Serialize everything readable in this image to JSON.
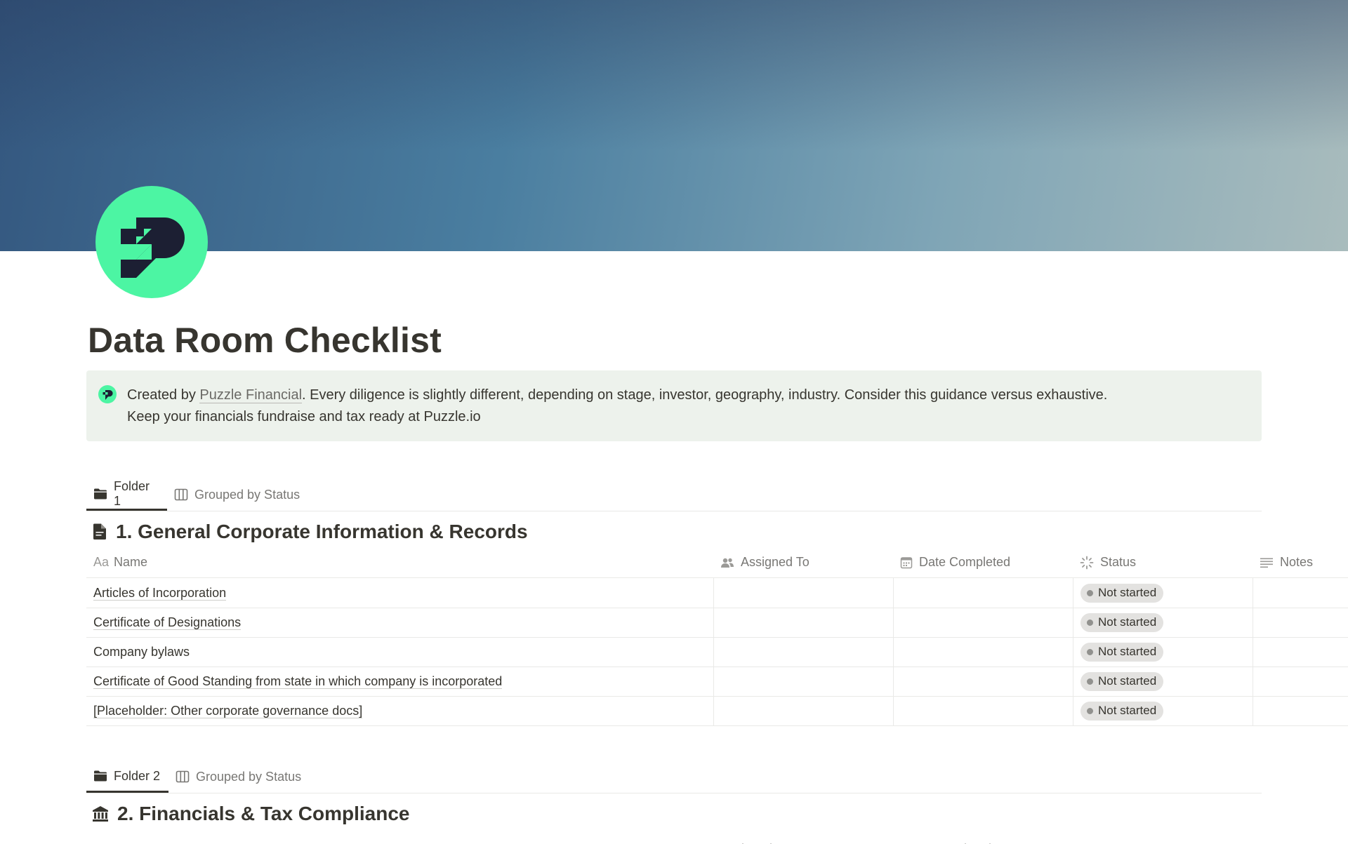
{
  "page": {
    "title": "Data Room Checklist",
    "icon": "puzzle-logo-icon",
    "accent": "#4cf5a3"
  },
  "callout": {
    "prefix": "Created by ",
    "link": "Puzzle Financial",
    "text": ". Every diligence is slightly different, depending on stage, investor, geography, industry.  Consider this guidance versus exhaustive.",
    "line2": "Keep your financials fundraise and tax ready at Puzzle.io"
  },
  "columns": {
    "name": "Name",
    "name_prefix": "Aa",
    "assigned": "Assigned To",
    "date": "Date Completed",
    "status": "Status",
    "notes": "Notes"
  },
  "sections": [
    {
      "tabs": [
        {
          "label": "Folder 1",
          "icon": "folder-icon",
          "active": true
        },
        {
          "label": "Grouped by Status",
          "icon": "board-icon",
          "active": false
        }
      ],
      "title": "1. General Corporate Information & Records",
      "icon": "document-icon",
      "rows": [
        {
          "name": "Articles of Incorporation",
          "assigned": "",
          "date": "",
          "status": "Not started",
          "notes": ""
        },
        {
          "name": "Certificate of Designations",
          "assigned": "",
          "date": "",
          "status": "Not started",
          "notes": ""
        },
        {
          "name": "Company bylaws",
          "assigned": "",
          "date": "",
          "status": "Not started",
          "notes": ""
        },
        {
          "name": "Certificate of Good Standing from state in which company is incorporated",
          "assigned": "",
          "date": "",
          "status": "Not started",
          "notes": ""
        },
        {
          "name": "[Placeholder: Other corporate governance docs]",
          "assigned": "",
          "date": "",
          "status": "Not started",
          "notes": ""
        }
      ]
    },
    {
      "tabs": [
        {
          "label": "Folder 2",
          "icon": "folder-icon",
          "active": true
        },
        {
          "label": "Grouped by Status",
          "icon": "board-icon",
          "active": false
        }
      ],
      "title": "2. Financials & Tax Compliance",
      "icon": "bank-icon",
      "rows": []
    }
  ]
}
